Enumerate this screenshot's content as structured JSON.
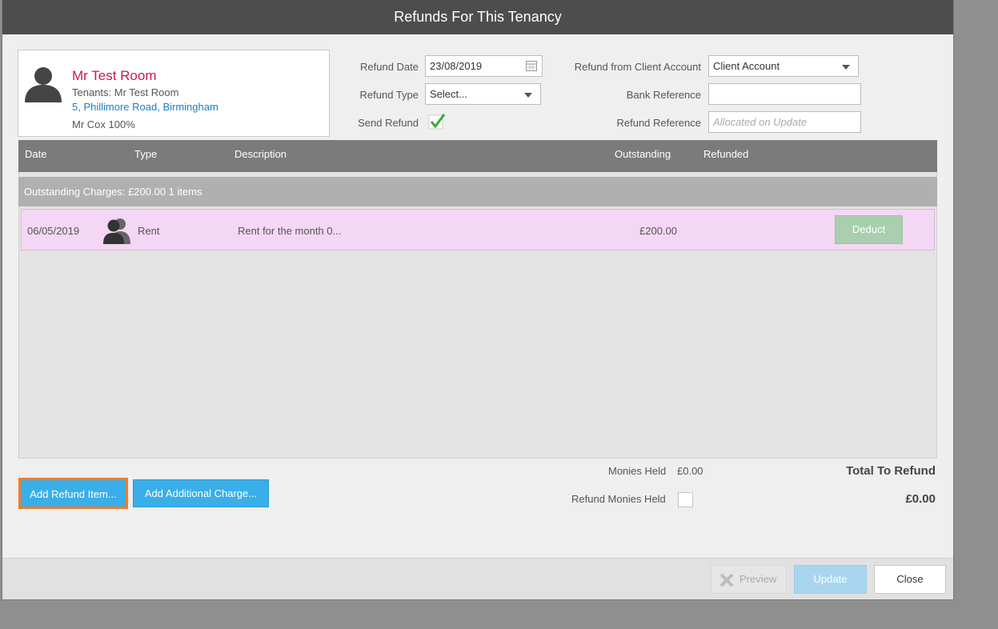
{
  "dialog": {
    "title": "Refunds For This Tenancy"
  },
  "tenant": {
    "name": "Mr Test Room",
    "tenants": "Tenants: Mr Test Room",
    "address": "5, Phillimore Road, Birmingham",
    "share": "Mr Cox 100%"
  },
  "form": {
    "refund_date_label": "Refund Date",
    "refund_date_value": "23/08/2019",
    "refund_type_label": "Refund Type",
    "refund_type_value": "Select...",
    "send_refund_label": "Send Refund",
    "send_refund_checked": true,
    "client_account_label": "Refund from Client Account",
    "client_account_value": "Client Account",
    "bank_ref_label": "Bank Reference",
    "bank_ref_value": "",
    "refund_ref_label": "Refund Reference",
    "refund_ref_placeholder": "Allocated on Update"
  },
  "grid": {
    "columns": [
      "Date",
      "Type",
      "Description",
      "Outstanding",
      "Refunded"
    ],
    "group_label": "Outstanding Charges: £200.00 1 items",
    "rows": [
      {
        "date": "06/05/2019",
        "type": "Rent",
        "description": "Rent for the month 0...",
        "outstanding": "£200.00",
        "action": "Deduct"
      }
    ]
  },
  "actions": {
    "add_refund_item": "Add Refund Item...",
    "add_additional_charge": "Add Additional Charge..."
  },
  "totals": {
    "monies_held_label": "Monies Held",
    "monies_held_value": "£0.00",
    "refund_monies_held_label": "Refund Monies Held",
    "total_to_refund_label": "Total To Refund",
    "total_to_refund_value": "£0.00"
  },
  "footer": {
    "preview": "Preview",
    "update": "Update",
    "close": "Close"
  },
  "colors": {
    "titlebar": "#4d4d4d",
    "tenant_name": "#c2185b",
    "link": "#1a7fc1",
    "row_highlight": "#f4d7f4",
    "primary_button": "#3aaee8",
    "focus_outline": "#f07c2a"
  }
}
